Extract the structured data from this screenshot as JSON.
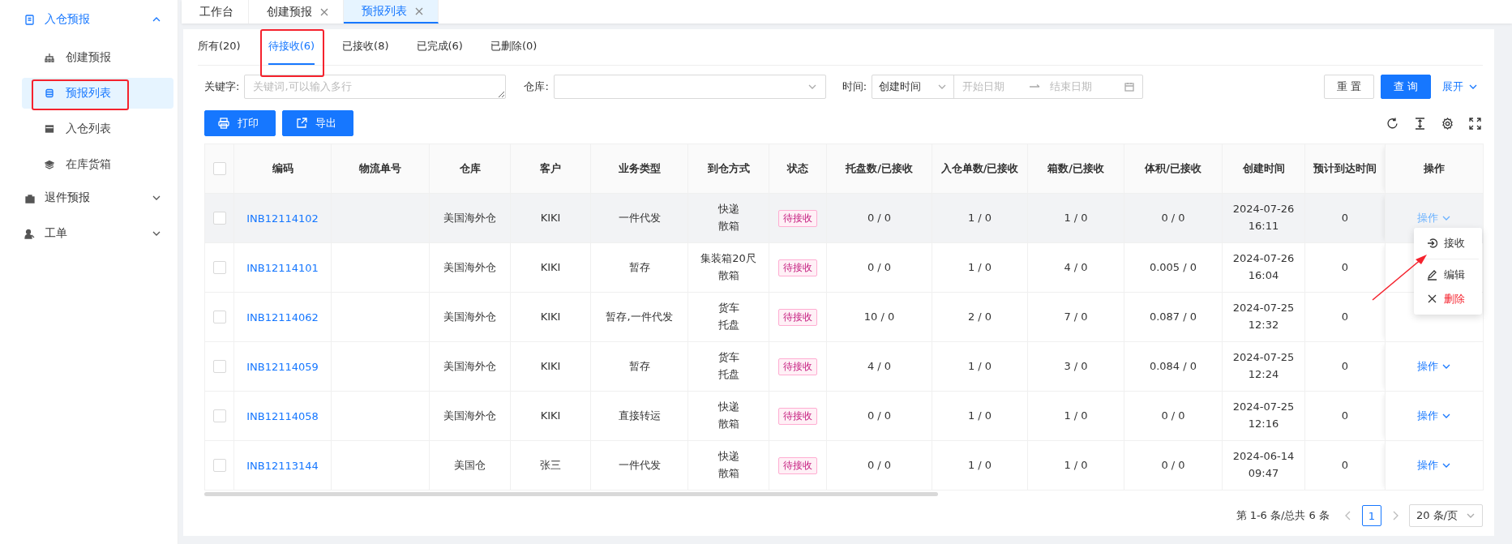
{
  "sidebar": {
    "items": [
      {
        "label": "入仓预报",
        "active": true,
        "expanded": true,
        "children": [
          {
            "label": "创建预报",
            "selected": false,
            "highlighted": false
          },
          {
            "label": "预报列表",
            "selected": true,
            "highlighted": true
          },
          {
            "label": "入仓列表",
            "selected": false,
            "highlighted": false
          },
          {
            "label": "在库货箱",
            "selected": false,
            "highlighted": false
          }
        ]
      },
      {
        "label": "退件预报",
        "active": false,
        "expanded": false
      },
      {
        "label": "工单",
        "active": false,
        "expanded": false
      }
    ]
  },
  "page_tabs": [
    {
      "label": "工作台",
      "closable": false,
      "selected": false
    },
    {
      "label": "创建预报",
      "closable": true,
      "selected": false
    },
    {
      "label": "预报列表",
      "closable": true,
      "selected": true
    }
  ],
  "status_tabs": [
    {
      "label": "所有(20)",
      "selected": false,
      "highlighted": false
    },
    {
      "label": "待接收(6)",
      "selected": true,
      "highlighted": true
    },
    {
      "label": "已接收(8)",
      "selected": false,
      "highlighted": false
    },
    {
      "label": "已完成(6)",
      "selected": false,
      "highlighted": false
    },
    {
      "label": "已删除(0)",
      "selected": false,
      "highlighted": false
    }
  ],
  "filters": {
    "keyword": {
      "label": "关键字:",
      "placeholder": "关键词,可以输入多行"
    },
    "warehouse": {
      "label": "仓库:"
    },
    "time": {
      "label": "时间:",
      "type_value": "创建时间",
      "start_placeholder": "开始日期",
      "end_placeholder": "结束日期"
    },
    "buttons": [
      {
        "label": "重 置",
        "kind": "default"
      },
      {
        "label": "查 询",
        "kind": "primary"
      }
    ],
    "expand_link": "展开"
  },
  "toolbar": {
    "buttons": [
      {
        "label": "打印"
      },
      {
        "label": "导出"
      }
    ]
  },
  "table": {
    "header_checked": false,
    "columns": [
      "编码",
      "物流单号",
      "仓库",
      "客户",
      "业务类型",
      "到仓方式",
      "状态",
      "托盘数/已接收",
      "入仓单数/已接收",
      "箱数/已接收",
      "体积/已接收",
      "创建时间",
      "预计到达时间",
      "操作"
    ],
    "rows": [
      {
        "checked": false,
        "hovered": true,
        "code": "INB12114102",
        "warehouse": "美国海外仓",
        "customer": "KIKI",
        "business_type": "一件代发",
        "arrival_method": [
          "快递",
          "散箱"
        ],
        "status": "待接收",
        "pallets": "0 / 0",
        "orders": "1 / 0",
        "boxes": "1 / 0",
        "volume": "0 / 0",
        "created": "2024-07-26\n16:11",
        "eta": "0",
        "action": "操作"
      },
      {
        "checked": false,
        "hovered": false,
        "code": "INB12114101",
        "warehouse": "美国海外仓",
        "customer": "KIKI",
        "business_type": "暂存",
        "arrival_method": [
          "集装箱20尺",
          "散箱"
        ],
        "status": "待接收",
        "pallets": "0 / 0",
        "orders": "1 / 0",
        "boxes": "4 / 0",
        "volume": "0.005 / 0",
        "created": "2024-07-26\n16:04",
        "eta": "0"
      },
      {
        "checked": false,
        "hovered": false,
        "code": "INB12114062",
        "warehouse": "美国海外仓",
        "customer": "KIKI",
        "business_type": "暂存,一件代发",
        "arrival_method": [
          "货车",
          "托盘"
        ],
        "status": "待接收",
        "pallets": "10 / 0",
        "orders": "2 / 0",
        "boxes": "7 / 0",
        "volume": "0.087 / 0",
        "created": "2024-07-25\n12:32",
        "eta": "0"
      },
      {
        "checked": false,
        "hovered": false,
        "code": "INB12114059",
        "warehouse": "美国海外仓",
        "customer": "KIKI",
        "business_type": "暂存",
        "arrival_method": [
          "货车",
          "托盘"
        ],
        "status": "待接收",
        "pallets": "4 / 0",
        "orders": "1 / 0",
        "boxes": "3 / 0",
        "volume": "0.084 / 0",
        "created": "2024-07-25\n12:24",
        "eta": "0",
        "action": "操作"
      },
      {
        "checked": false,
        "hovered": false,
        "code": "INB12114058",
        "warehouse": "美国海外仓",
        "customer": "KIKI",
        "business_type": "直接转运",
        "arrival_method": [
          "快递",
          "散箱"
        ],
        "status": "待接收",
        "pallets": "0 / 0",
        "orders": "1 / 0",
        "boxes": "1 / 0",
        "volume": "0 / 0",
        "created": "2024-07-25\n12:16",
        "eta": "0",
        "action": "操作"
      },
      {
        "checked": false,
        "hovered": false,
        "code": "INB12113144",
        "warehouse": "美国仓",
        "customer": "张三",
        "business_type": "一件代发",
        "arrival_method": [
          "快递",
          "散箱"
        ],
        "status": "待接收",
        "pallets": "0 / 0",
        "orders": "1 / 0",
        "boxes": "1 / 0",
        "volume": "0 / 0",
        "created": "2024-06-14\n09:47",
        "eta": "0",
        "action": "操作"
      }
    ]
  },
  "row_menu": {
    "arrow_annotation": true,
    "items": [
      {
        "label": "接收",
        "kind": "normal"
      },
      {
        "label": "编辑",
        "kind": "normal"
      },
      {
        "label": "删除",
        "kind": "danger"
      }
    ]
  },
  "pagination": {
    "summary": "第 1-6 条/总共 6 条",
    "pages": [
      {
        "label": "1",
        "selected": true
      }
    ],
    "page_size": "20 条/页"
  }
}
